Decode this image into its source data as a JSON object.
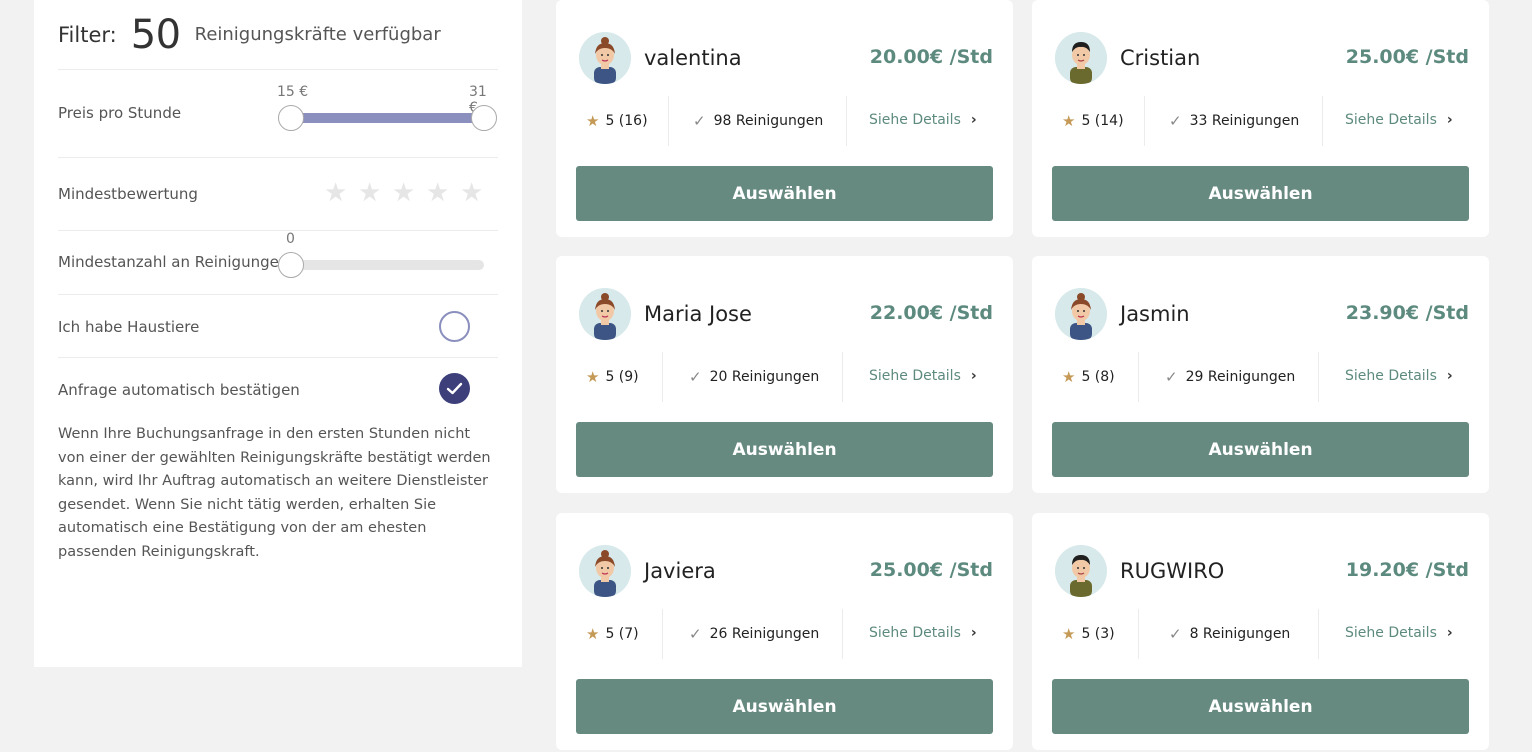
{
  "filter": {
    "label": "Filter:",
    "count": "50",
    "available_text": "Reinigungskräfte verfügbar",
    "price": {
      "label": "Preis pro Stunde",
      "min_label": "15 €",
      "max_label": "31 €"
    },
    "rating": {
      "label": "Mindestbewertung",
      "stars": [
        "★",
        "★",
        "★",
        "★",
        "★"
      ]
    },
    "cleanings": {
      "label": "Mindestanzahl an Reinigungen",
      "value": "0"
    },
    "pets": {
      "label": "Ich habe Haustiere",
      "checked": false
    },
    "auto_confirm": {
      "label": "Anfrage automatisch bestätigen",
      "checked": true,
      "description": "Wenn Ihre Buchungsanfrage in den ersten Stunden nicht von einer der gewählten Reinigungskräfte bestätigt werden kann, wird Ihr Auftrag automatisch an weitere Dienstleister gesendet. Wenn Sie nicht tätig werden, erhalten Sie automatisch eine Bestätigung von der am ehesten passenden Reinigungskraft."
    }
  },
  "cards": [
    {
      "name": "valentina",
      "price": "20.00€ /Std",
      "rating": "5 (16)",
      "cleanings": "98 Reinigungen",
      "details": "Siehe Details",
      "button": "Auswählen",
      "avatar": "female"
    },
    {
      "name": "Cristian",
      "price": "25.00€ /Std",
      "rating": "5 (14)",
      "cleanings": "33 Reinigungen",
      "details": "Siehe Details",
      "button": "Auswählen",
      "avatar": "male"
    },
    {
      "name": "Maria Jose",
      "price": "22.00€ /Std",
      "rating": "5 (9)",
      "cleanings": "20 Reinigungen",
      "details": "Siehe Details",
      "button": "Auswählen",
      "avatar": "female"
    },
    {
      "name": "Jasmin",
      "price": "23.90€ /Std",
      "rating": "5 (8)",
      "cleanings": "29 Reinigungen",
      "details": "Siehe Details",
      "button": "Auswählen",
      "avatar": "female"
    },
    {
      "name": "Javiera",
      "price": "25.00€ /Std",
      "rating": "5 (7)",
      "cleanings": "26 Reinigungen",
      "details": "Siehe Details",
      "button": "Auswählen",
      "avatar": "female"
    },
    {
      "name": "RUGWIRO",
      "price": "19.20€ /Std",
      "rating": "5 (3)",
      "cleanings": "8 Reinigungen",
      "details": "Siehe Details",
      "button": "Auswählen",
      "avatar": "male"
    }
  ]
}
